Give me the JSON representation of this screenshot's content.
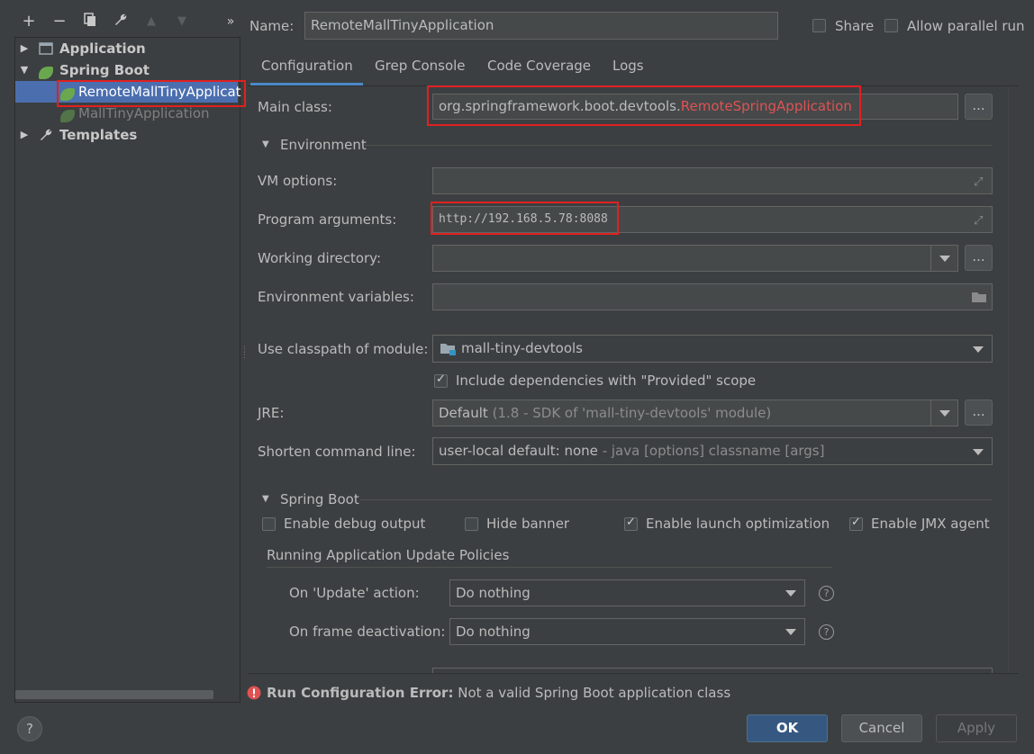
{
  "toolbar": {
    "add": "+",
    "remove": "−",
    "copy": "⧉",
    "edit": "🔧",
    "up": "▲",
    "down": "▼",
    "more": "»"
  },
  "tree": {
    "items": [
      {
        "label": "Application"
      },
      {
        "label": "Spring Boot"
      },
      {
        "label": "RemoteMallTinyApplicat"
      },
      {
        "label": "MallTinyApplication"
      },
      {
        "label": "Templates"
      }
    ]
  },
  "header": {
    "name_label": "Name:",
    "name_value": "RemoteMallTinyApplication",
    "share_label": "Share",
    "parallel_label": "Allow parallel run"
  },
  "tabs": [
    "Configuration",
    "Grep Console",
    "Code Coverage",
    "Logs"
  ],
  "config": {
    "main_class_label": "Main class:",
    "main_class_prefix": "org.springframework.boot.devtools.",
    "main_class_suffix": "RemoteSpringApplication",
    "dots": "...",
    "environment_section": "Environment",
    "vm_options_label": "VM options:",
    "program_args_label": "Program arguments:",
    "program_args_value": "http://192.168.5.78:8088",
    "working_dir_label": "Working directory:",
    "env_vars_label": "Environment variables:",
    "classpath_label": "Use classpath of module:",
    "classpath_value": "mall-tiny-devtools",
    "include_deps_label": "Include dependencies with \"Provided\" scope",
    "jre_label": "JRE:",
    "jre_value": "Default",
    "jre_detail": "(1.8 - SDK of 'mall-tiny-devtools' module)",
    "shorten_label": "Shorten command line:",
    "shorten_value": "user-local default: none",
    "shorten_detail": "- java [options] classname [args]"
  },
  "spring_boot": {
    "section": "Spring Boot",
    "debug_output": "Enable debug output",
    "hide_banner": "Hide banner",
    "launch_opt": "Enable launch optimization",
    "jmx_agent": "Enable JMX agent",
    "policies_title": "Running Application Update Policies",
    "on_update_label": "On 'Update' action:",
    "on_update_value": "Do nothing",
    "on_frame_label": "On frame deactivation:",
    "on_frame_value": "Do nothing",
    "help": "?"
  },
  "error": {
    "title": "Run Configuration Error:",
    "message": "Not a valid Spring Boot application class"
  },
  "buttons": {
    "help": "?",
    "ok": "OK",
    "cancel": "Cancel",
    "apply": "Apply"
  },
  "colors": {
    "accent": "#365880",
    "highlight": "#e05252",
    "error": "#e05252"
  }
}
